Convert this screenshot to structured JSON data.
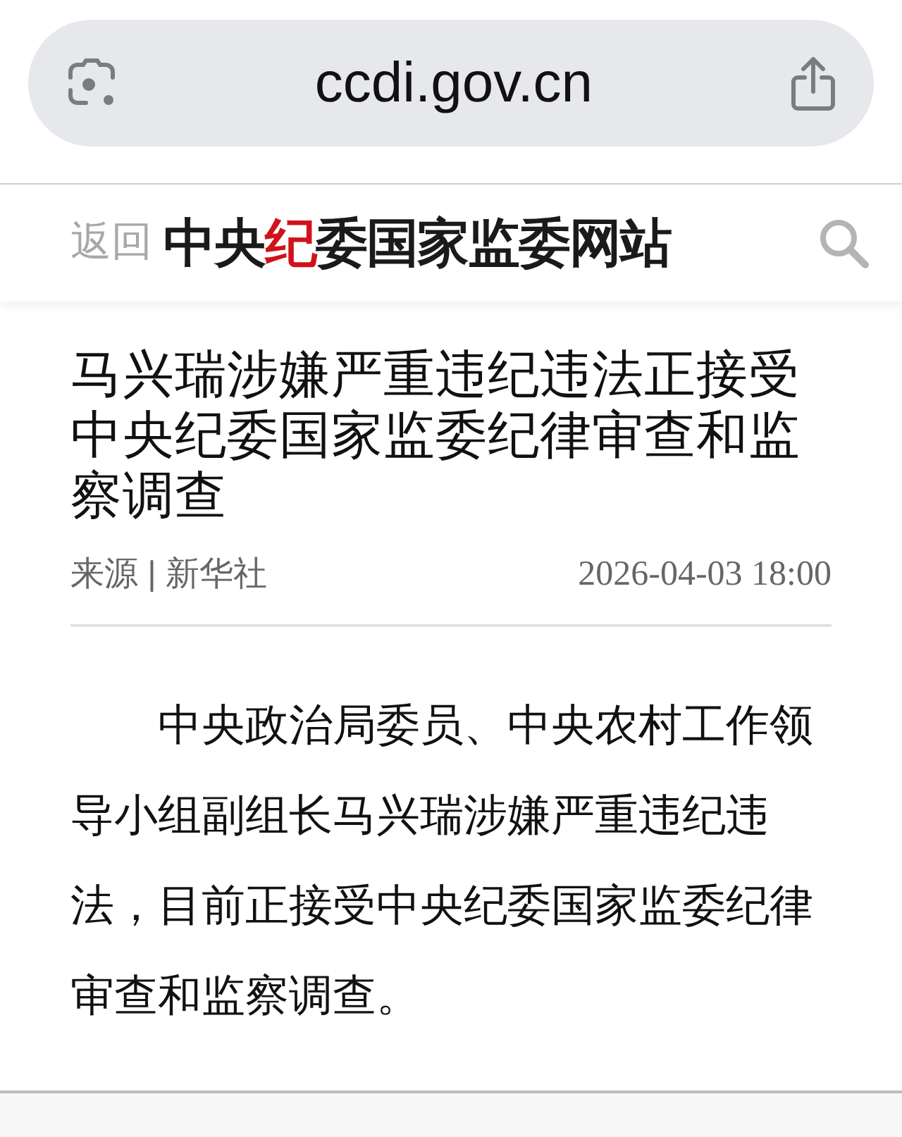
{
  "browser": {
    "url": "ccdi.gov.cn"
  },
  "header": {
    "back": "返回",
    "logo": [
      {
        "text": "中央",
        "highlighted": false
      },
      {
        "text": "纪",
        "highlighted": true
      },
      {
        "text": "委国家监委网站",
        "highlighted": false
      }
    ]
  },
  "article": {
    "title": "马兴瑞涉嫌严重违纪违法正接受中央纪委国家监委纪律审查和监察调查",
    "source": "来源 | 新华社",
    "date": "2026-04-03 18:00",
    "body": [
      "中央政治局委员、中央农村工作领导小组副组长马兴瑞涉嫌严重违纪违法，目前正接受中央纪委国家监委纪律审查和监察调查。"
    ]
  }
}
